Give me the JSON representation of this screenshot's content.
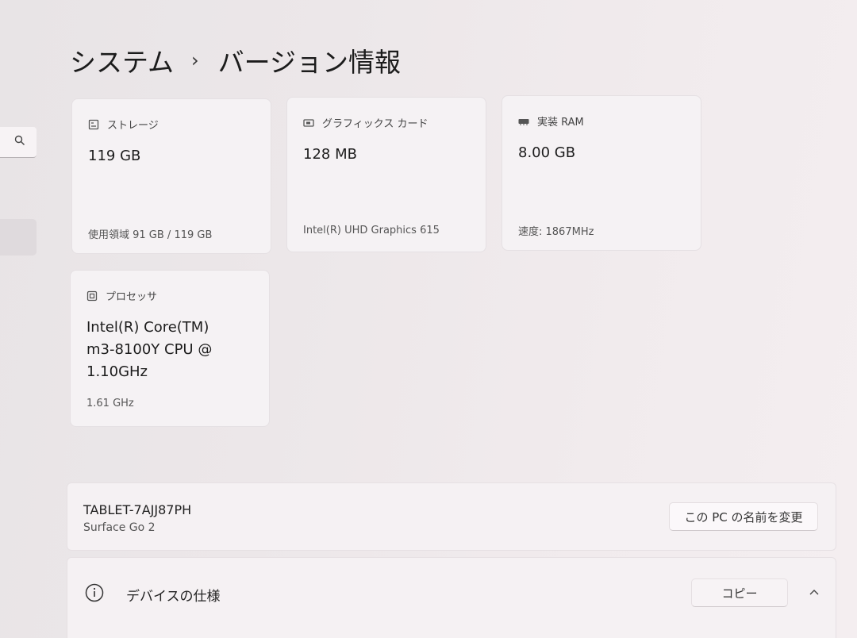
{
  "breadcrumb": {
    "parent": "システム",
    "separator": "›",
    "current": "バージョン情報"
  },
  "cards": {
    "storage": {
      "title": "ストレージ",
      "value": "119 GB",
      "detail": "使用領域 91 GB / 119 GB",
      "icon": "storage-icon"
    },
    "graphics": {
      "title": "グラフィックス カード",
      "value": "128 MB",
      "detail": "Intel(R) UHD Graphics 615",
      "icon": "graphics-card-icon"
    },
    "ram": {
      "title": "実装 RAM",
      "value": "8.00 GB",
      "detail": "速度: 1867MHz",
      "icon": "memory-icon"
    },
    "processor": {
      "title": "プロセッサ",
      "value_lines": [
        "Intel(R) Core(TM)",
        "m3-8100Y CPU @",
        "1.10GHz"
      ],
      "detail": "1.61 GHz",
      "icon": "processor-icon"
    }
  },
  "device": {
    "name": "TABLET-7AJJ87PH",
    "model": "Surface Go 2",
    "rename_label": "この PC の名前を変更"
  },
  "specs_section": {
    "label": "デバイスの仕様",
    "copy_label": "コピー",
    "icon": "info-icon",
    "expand_icon": "chevron-up-icon"
  }
}
